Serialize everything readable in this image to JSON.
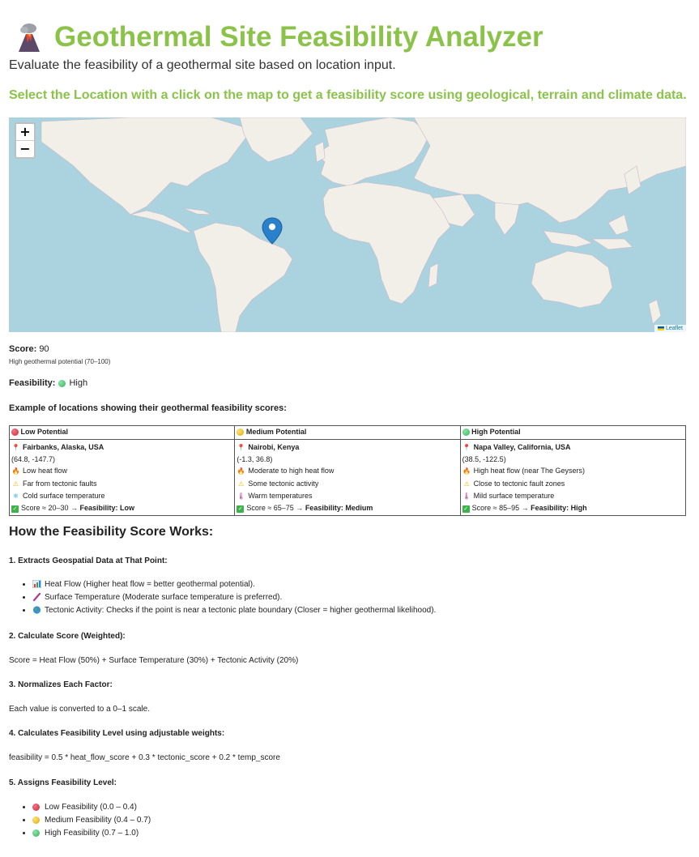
{
  "header": {
    "title": "Geothermal Site Feasibility Analyzer",
    "subtitle": "Evaluate the feasibility of a geothermal site based on location input.",
    "instruction": "Select the Location with a click on the map to get a feasibility score using geological, terrain and climate data."
  },
  "map": {
    "zoom_in": "+",
    "zoom_out": "−",
    "attribution": "Leaflet"
  },
  "result": {
    "score_label": "Score:",
    "score_value": "90",
    "score_note": "High geothermal potential (70–100)",
    "feasibility_label": "Feasibility:",
    "feasibility_value": "High"
  },
  "examples": {
    "title": "Example of locations showing their geothermal feasibility scores:",
    "columns": [
      {
        "header": "Low Potential",
        "place": "Fairbanks, Alaska, USA",
        "coords": "(64.8, -147.7)",
        "facts": [
          "Low heat flow",
          "Far from tectonic faults",
          "Cold surface temperature"
        ],
        "score_text": "Score ≈ 20–30 → ",
        "feasibility_text": "Feasibility: Low"
      },
      {
        "header": "Medium Potential",
        "place": "Nairobi, Kenya",
        "coords": "(-1.3, 36.8)",
        "facts": [
          "Moderate to high heat flow",
          "Some tectonic activity",
          "Warm temperatures"
        ],
        "score_text": "Score ≈ 65–75 → ",
        "feasibility_text": "Feasibility: Medium"
      },
      {
        "header": "High Potential",
        "place": "Napa Valley, California, USA",
        "coords": "(38.5, -122.5)",
        "facts": [
          "High heat flow (near The Geysers)",
          "Close to tectonic fault zones",
          "Mild surface temperature"
        ],
        "score_text": "Score ≈ 85–95 → ",
        "feasibility_text": "Feasibility: High"
      }
    ]
  },
  "how": {
    "title": "How the Feasibility Score Works:",
    "step1": "1. Extracts Geospatial Data at That Point:",
    "step1_items": [
      "Heat Flow (Higher heat flow = better geothermal potential).",
      "Surface Temperature (Moderate surface temperature is preferred).",
      "Tectonic Activity: Checks if the point is near a tectonic plate boundary (Closer = higher geothermal likelihood)."
    ],
    "step2": "2. Calculate Score (Weighted):",
    "step2_text": "Score = Heat Flow (50%) + Surface Temperature (30%) + Tectonic Activity (20%)",
    "step3": "3. Normalizes Each Factor:",
    "step3_text": "Each value is converted to a 0–1 scale.",
    "step4": "4. Calculates Feasibility Level using adjustable weights:",
    "step4_text": "feasibility = 0.5 * heat_flow_score + 0.3 * tectonic_score + 0.2 * temp_score",
    "step5": "5. Assigns Feasibility Level:",
    "step5_items": [
      "Low Feasibility (0.0 – 0.4)",
      "Medium Feasibility (0.4 – 0.7)",
      "High Feasibility (0.7 – 1.0)"
    ]
  },
  "colors": {
    "accent": "#8bc34a",
    "ocean": "#aad3df",
    "land": "#f2efe9",
    "marker": "#2a81cb"
  }
}
